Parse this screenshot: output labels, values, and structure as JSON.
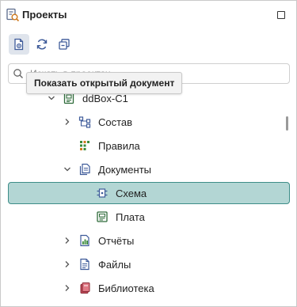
{
  "header": {
    "title": "Проекты"
  },
  "toolbar": {
    "buttons": [
      {
        "icon": "show-open-document-icon",
        "active": true
      },
      {
        "icon": "refresh-icon",
        "active": false
      },
      {
        "icon": "collapse-all-icon",
        "active": false
      }
    ]
  },
  "search": {
    "placeholder": "Искать в проектах",
    "value": ""
  },
  "tooltip": {
    "text": "Показать открытый документ"
  },
  "tree": {
    "items": [
      {
        "label": "ddBox-C1",
        "icon": "board-icon",
        "expanded": true
      },
      {
        "label": "Состав",
        "icon": "structure-icon",
        "expanded": false
      },
      {
        "label": "Правила",
        "icon": "rules-icon"
      },
      {
        "label": "Документы",
        "icon": "documents-icon",
        "expanded": true
      },
      {
        "label": "Схема",
        "icon": "schematic-icon",
        "selected": true
      },
      {
        "label": "Плата",
        "icon": "pcb-icon"
      },
      {
        "label": "Отчёты",
        "icon": "reports-icon",
        "expanded": false
      },
      {
        "label": "Файлы",
        "icon": "files-icon",
        "expanded": false
      },
      {
        "label": "Библиотека",
        "icon": "library-icon",
        "expanded": false
      }
    ]
  },
  "colors": {
    "selection_bg": "#b3d6d4",
    "selection_border": "#3d8d88",
    "active_button_bg": "#dfe4ec"
  }
}
